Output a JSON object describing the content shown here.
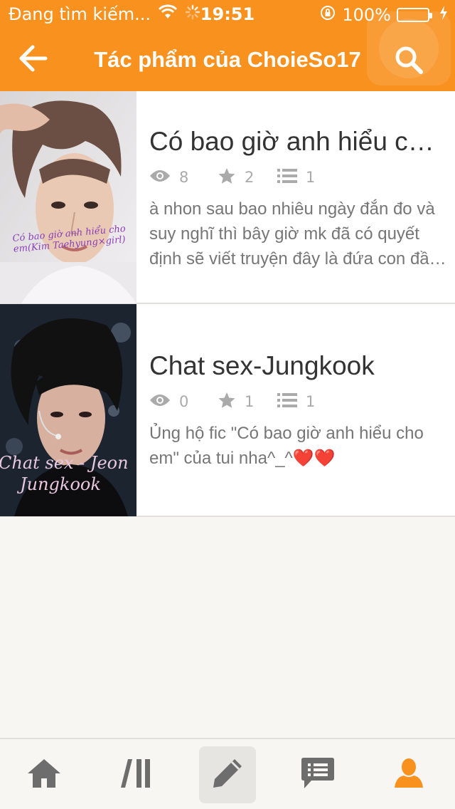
{
  "status_bar": {
    "carrier": "Đang tìm kiếm...",
    "time": "19:51",
    "battery": "100%"
  },
  "header": {
    "title": "Tác phẩm của ChoieSo17",
    "back_icon": "arrow-left-icon",
    "search_icon": "search-icon"
  },
  "stories": [
    {
      "title": "Có bao giờ anh hiểu cho em",
      "views": "8",
      "votes": "2",
      "parts": "1",
      "description": "à nhon sau bao nhiêu ngày đắn đo và suy nghĩ thì bây giờ mk đã có quyết định sẽ viết truyện  đây là đứa con đầu lòng của tui",
      "cover_text_1": "Có bao giờ anh hiểu cho",
      "cover_text_2": "em(Kim Taehyung×girl)"
    },
    {
      "title": "Chat sex-Jungkook",
      "views": "0",
      "votes": "1",
      "parts": "1",
      "description": "Ủng hộ fic \"Có bao giờ anh hiểu cho em\" của tui nha^_^❤️❤️",
      "cover_text_1": "Chat sex - Jeon",
      "cover_text_2": "Jungkook"
    }
  ],
  "tabbar": {
    "items": [
      "home-icon",
      "library-icon",
      "write-icon",
      "messages-icon",
      "profile-icon"
    ],
    "active": "write-icon"
  },
  "colors": {
    "accent": "#f9911f",
    "stat_gray": "#aaaaaa",
    "tab_gray": "#6d6d6d"
  }
}
